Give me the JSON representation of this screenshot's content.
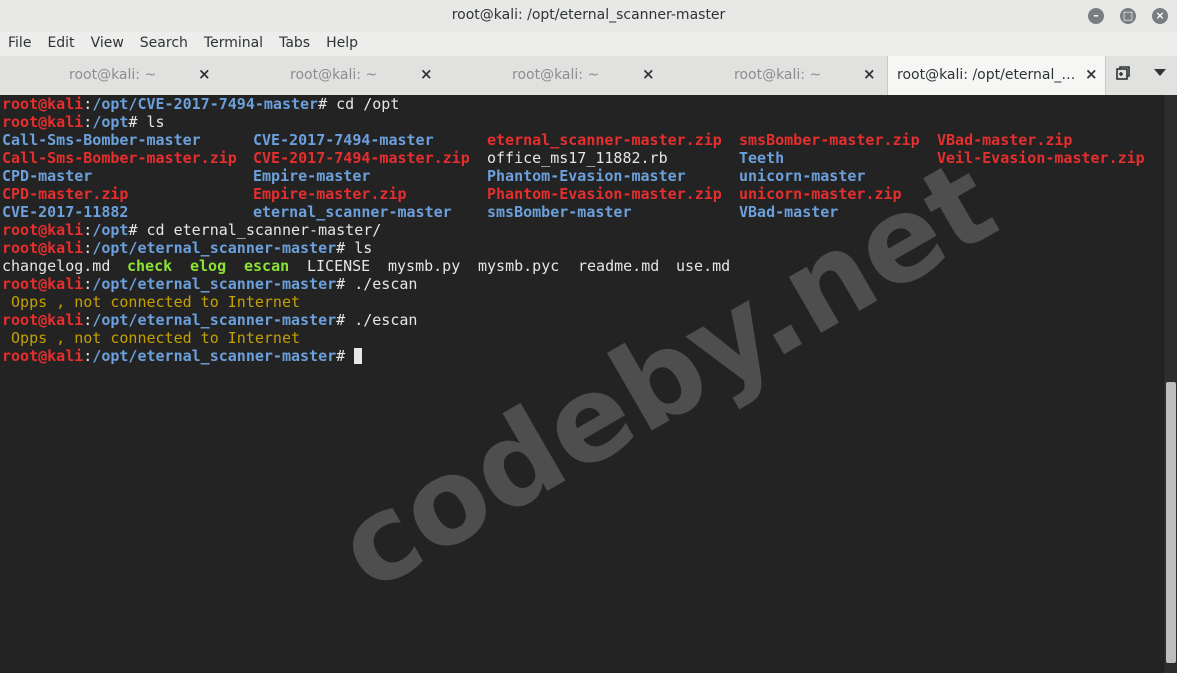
{
  "window": {
    "title": "root@kali: /opt/eternal_scanner-master"
  },
  "menu": [
    "File",
    "Edit",
    "View",
    "Search",
    "Terminal",
    "Tabs",
    "Help"
  ],
  "tabs": [
    {
      "label": "root@kali: ~",
      "active": false
    },
    {
      "label": "root@kali: ~",
      "active": false
    },
    {
      "label": "root@kali: ~",
      "active": false
    },
    {
      "label": "root@kali: ~",
      "active": false
    },
    {
      "label": "root@kali: /opt/eternal_…",
      "active": true
    }
  ],
  "tab_close_glyph": "×",
  "prompt": {
    "user": "root@kali",
    "sep": ":"
  },
  "lines": [
    {
      "path": "/opt/CVE-2017-7494-master",
      "cmd": "# cd /opt"
    },
    {
      "path": "/opt",
      "cmd": "# ls"
    },
    {
      "path": "/opt",
      "cmd": "# cd eternal_scanner-master/"
    },
    {
      "path": "/opt/eternal_scanner-master",
      "cmd": "# ls"
    },
    {
      "path": "/opt/eternal_scanner-master",
      "cmd": "# ./escan"
    },
    {
      "path": "/opt/eternal_scanner-master",
      "cmd": "# ./escan"
    },
    {
      "path": "/opt/eternal_scanner-master",
      "cmd": "# "
    }
  ],
  "ls_opt": [
    [
      "Call-Sms-Bomber-master",
      "CVE-2017-7494-master",
      "eternal_scanner-master.zip",
      "smsBomber-master.zip",
      "VBad-master.zip"
    ],
    [
      "Call-Sms-Bomber-master.zip",
      "CVE-2017-7494-master.zip",
      "office_ms17_11882.rb",
      "Teeth",
      "Veil-Evasion-master.zip"
    ],
    [
      "CPD-master",
      "Empire-master",
      "Phantom-Evasion-master",
      "unicorn-master",
      ""
    ],
    [
      "CPD-master.zip",
      "Empire-master.zip",
      "Phantom-Evasion-master.zip",
      "unicorn-master.zip",
      ""
    ],
    [
      "CVE-2017-11882",
      "eternal_scanner-master",
      "smsBomber-master",
      "VBad-master",
      ""
    ]
  ],
  "ls_scanner": [
    "changelog.md",
    "check",
    "elog",
    "escan",
    "LICENSE",
    "mysmb.py",
    "mysmb.pyc",
    "readme.md",
    "use.md"
  ],
  "escan_output": " Opps , not connected to Internet",
  "watermark": "codeby.net",
  "colors": {
    "user": "#e52e2e",
    "path": "#6ca0dc",
    "exec": "#8ae234",
    "warn": "#c4a000"
  }
}
